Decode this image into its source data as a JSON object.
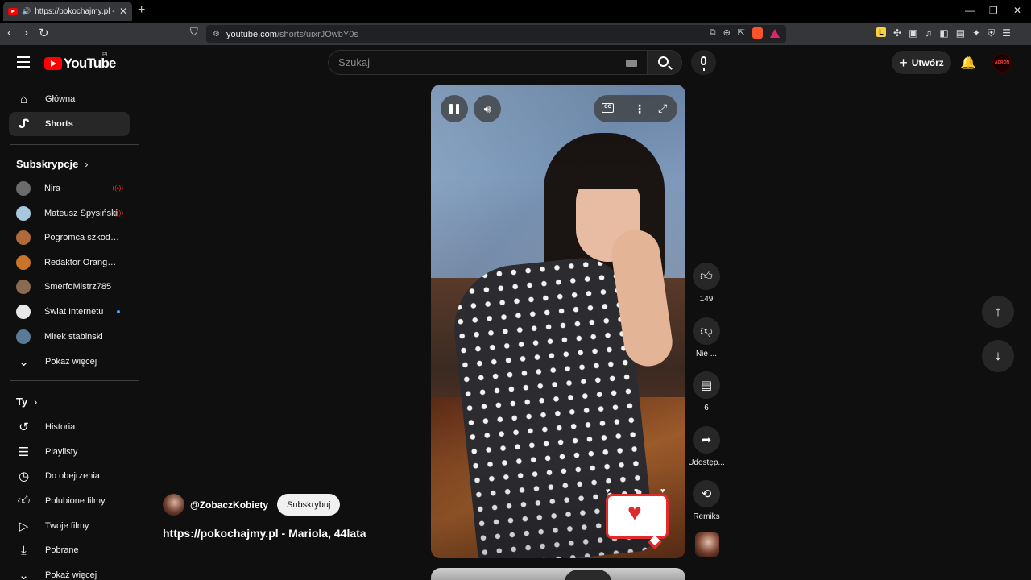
{
  "browser": {
    "tab_title": "https://pokochajmy.pl - Mario",
    "tab_close": "✕",
    "new_tab": "+",
    "url_host": "youtube.com",
    "url_path": "/shorts/uixrJOwbY0s",
    "brave_badge": "",
    "window_controls": [
      "—",
      "❐",
      "✕"
    ]
  },
  "header": {
    "logo_text": "YouTube",
    "region": "PL",
    "search_placeholder": "Szukaj",
    "create_label": "Utwórz",
    "avatar_text": "ADRON"
  },
  "sidebar": {
    "main": [
      {
        "label": "Główna",
        "icon": "home-icon"
      },
      {
        "label": "Shorts",
        "icon": "shorts-icon",
        "active": true
      }
    ],
    "subscriptions_heading": "Subskrypcje",
    "subscriptions": [
      {
        "label": "Nira",
        "live": true,
        "color": "#6b6b6b"
      },
      {
        "label": "Mateusz Spysiński",
        "live": true,
        "color": "#a8c8e0"
      },
      {
        "label": "Pogromca szkodni...",
        "live": false,
        "color": "#b06a3a"
      },
      {
        "label": "Redaktor Orangutan",
        "live": false,
        "color": "#c8742a"
      },
      {
        "label": "SmerfoMistrz785",
        "live": false,
        "color": "#8a6a50"
      },
      {
        "label": "Świat Internetu",
        "live": false,
        "new": true,
        "color": "#e8e8e8"
      },
      {
        "label": "Mirek stabinski",
        "live": false,
        "color": "#5a7a9a"
      }
    ],
    "show_more": "Pokaż więcej",
    "you_heading": "Ty",
    "you_items": [
      {
        "label": "Historia",
        "icon": "history-icon"
      },
      {
        "label": "Playlisty",
        "icon": "playlists-icon"
      },
      {
        "label": "Do obejrzenia",
        "icon": "watch-later-icon"
      },
      {
        "label": "Polubione filmy",
        "icon": "liked-icon"
      },
      {
        "label": "Twoje filmy",
        "icon": "your-videos-icon"
      },
      {
        "label": "Pobrane",
        "icon": "downloads-icon"
      },
      {
        "label": "Pokaż więcej",
        "icon": "chevron-down-icon"
      }
    ]
  },
  "short": {
    "channel": "@ZobaczKobiety",
    "subscribe_label": "Subskrybuj",
    "title": "https://pokochajmy.pl - Mariola, 44lata",
    "cc_label": "CC"
  },
  "actions": {
    "likes": "149",
    "dislike_label": "Nie ...",
    "comments": "6",
    "share_label": "Udostęp...",
    "remix_label": "Remiks"
  },
  "colors": {
    "background": "#0f0f0f",
    "accent": "#ff0000",
    "active_item": "#272727"
  }
}
